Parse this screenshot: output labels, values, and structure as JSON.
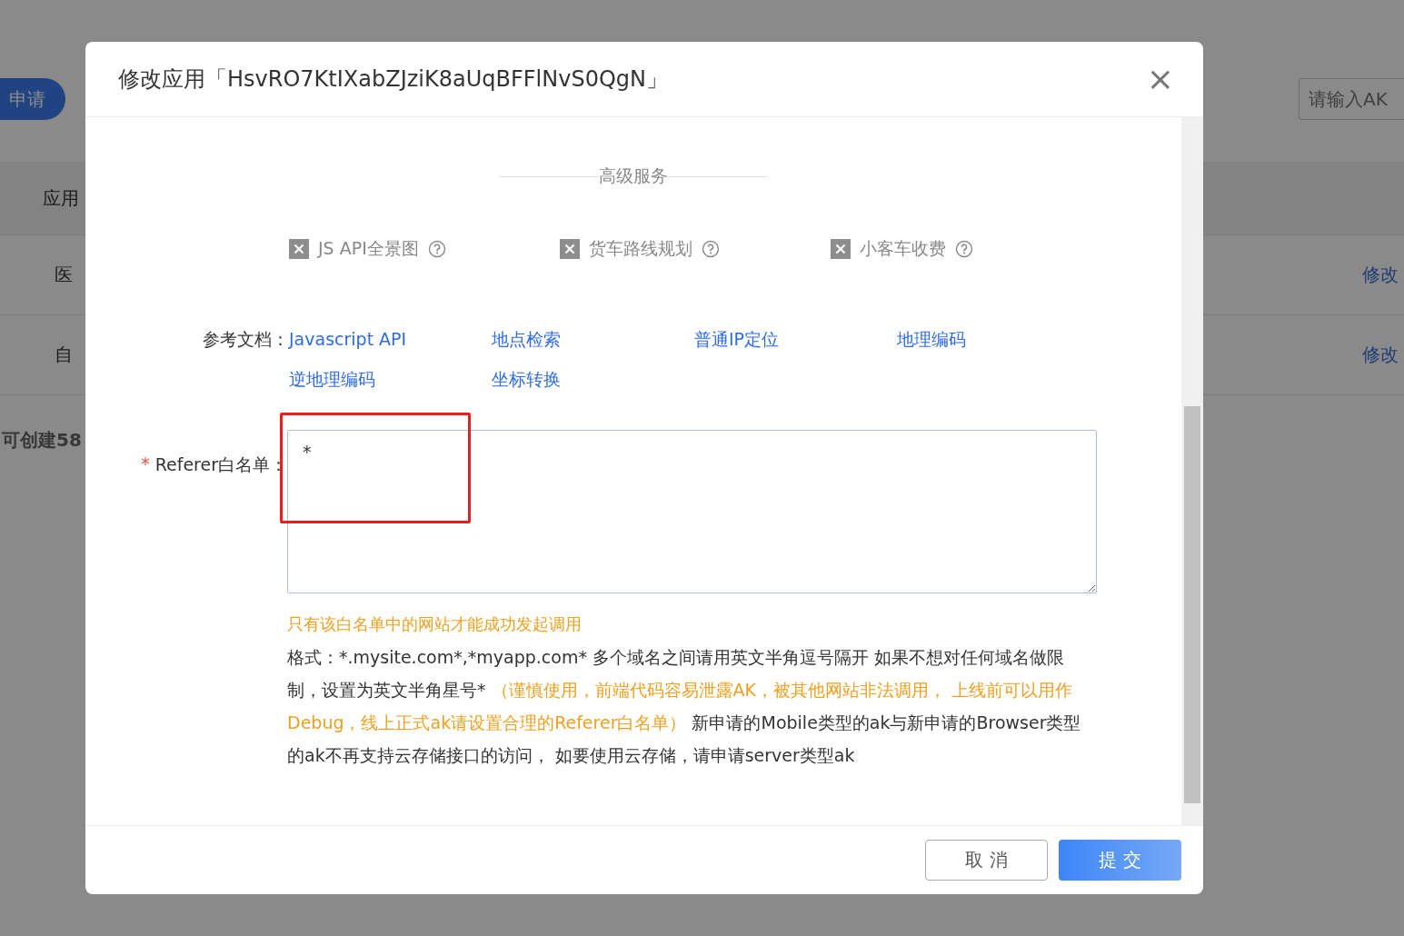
{
  "background": {
    "apply_button": "申请",
    "table": {
      "header": [
        "应用"
      ],
      "rows": [
        {
          "column_1": "医",
          "action": "修改"
        },
        {
          "column_1": "自",
          "action": "修改"
        }
      ]
    },
    "quota_note": "可创建58",
    "ak_search": {
      "placeholder": "请输入AK"
    }
  },
  "dialog": {
    "title": "修改应用「HsvRO7KtIXabZJziK8aUqBFFlNvS0QgN」",
    "close": "×",
    "section_title": "高级服务",
    "services": [
      {
        "label": "JS API全景图",
        "disabled": true
      },
      {
        "label": "货车路线规划",
        "disabled": true
      },
      {
        "label": "小客车收费",
        "disabled": true
      }
    ],
    "docs": {
      "label": "参考文档：",
      "links": [
        "Javascript API",
        "地点检索",
        "普通IP定位",
        "地理编码",
        "逆地理编码",
        "坐标转换"
      ]
    },
    "referer": {
      "required_mark": "*",
      "label": "Referer白名单：",
      "value": "*",
      "highlighted": true
    },
    "hint": "只有该白名单中的网站才能成功发起调用",
    "help": [
      {
        "kind": "note",
        "text": "格式：*.mysite.com*,*myapp.com* 多个域名之间请用英文半角逗号隔开 如果不想对任何域名做限制，设置为英文半角星号* "
      },
      {
        "kind": "warning",
        "text": "（谨慎使用，前端代码容易泄露AK，被其他网站非法调用， 上线前可以用作Debug，线上正式ak请设置合理的Referer白名单）"
      },
      {
        "kind": "note",
        "text": " 新申请的Mobile类型的ak与新申请的Browser类型的ak不再支持云存储接口的访问， 如要使用云存储，请申请server类型ak"
      }
    ],
    "buttons": [
      {
        "label": "取 消",
        "kind": "secondary"
      },
      {
        "label": "提 交",
        "kind": "primary"
      }
    ]
  }
}
